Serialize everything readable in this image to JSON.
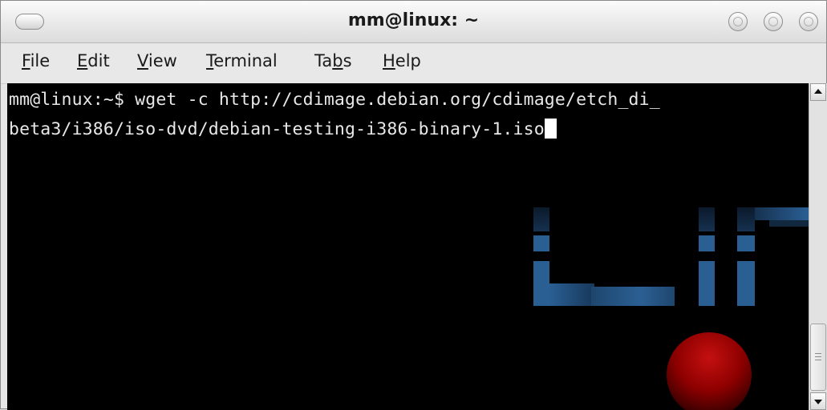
{
  "window": {
    "title": "mm@linux: ~"
  },
  "menu": [
    "File",
    "Edit",
    "View",
    "Terminal",
    "Tabs",
    "Help"
  ],
  "menu_mnemonic": [
    "F",
    "E",
    "V",
    "T",
    "b",
    "H"
  ],
  "terminal": {
    "line1": "mm@linux:~$ wget -c http://cdimage.debian.org/cdimage/etch_di_",
    "line2": "beta3/i386/iso-dvd/debian-testing-i386-binary-1.iso"
  },
  "colors": {
    "terminal_bg": "#000000",
    "terminal_fg": "#e8e8e8",
    "logo_blue": "#2a5f94",
    "ball_red": "#9e0000"
  },
  "icons": [
    "window-menu-pill-icon",
    "minimize-icon",
    "maximize-icon",
    "close-icon",
    "scroll-up-icon",
    "scroll-down-icon"
  ]
}
